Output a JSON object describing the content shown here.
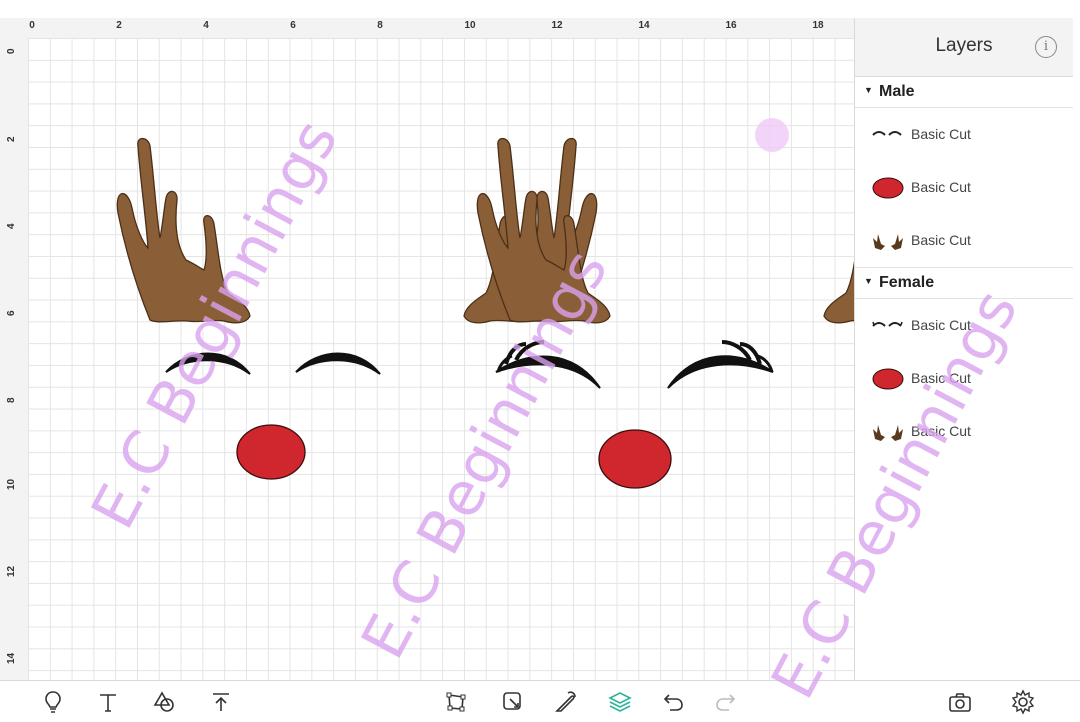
{
  "ruler": {
    "x_ticks": [
      "0",
      "2",
      "4",
      "6",
      "8",
      "10",
      "12",
      "14",
      "16",
      "18"
    ],
    "y_ticks": [
      "0",
      "2",
      "4",
      "6",
      "8",
      "10",
      "12",
      "14"
    ]
  },
  "layers_panel": {
    "title": "Layers",
    "info_icon": "info-icon",
    "groups": [
      {
        "name": "Male",
        "layers": [
          {
            "label": "Basic Cut",
            "thumb": "eyes-closed"
          },
          {
            "label": "Basic Cut",
            "thumb": "red-nose"
          },
          {
            "label": "Basic Cut",
            "thumb": "antlers"
          }
        ]
      },
      {
        "name": "Female",
        "layers": [
          {
            "label": "Basic Cut",
            "thumb": "eyes-lashes"
          },
          {
            "label": "Basic Cut",
            "thumb": "red-nose"
          },
          {
            "label": "Basic Cut",
            "thumb": "antlers"
          }
        ]
      }
    ]
  },
  "watermark": {
    "text": "E.C Beginnings"
  },
  "toolbar": {
    "left_tools": [
      "lightbulb-icon",
      "text-icon",
      "shapes-icon",
      "upload-icon"
    ],
    "center_tools": [
      "edit-nodes-icon",
      "attach-icon",
      "flatten-icon",
      "layers-icon",
      "undo-icon",
      "redo-icon"
    ],
    "right_tools": [
      "camera-icon",
      "settings-icon"
    ]
  },
  "colors": {
    "antler": "#8a5f38",
    "nose": "#d0262e",
    "lash": "#111111",
    "accent": "#2bb39a",
    "watermark": "#d9a3ee"
  }
}
